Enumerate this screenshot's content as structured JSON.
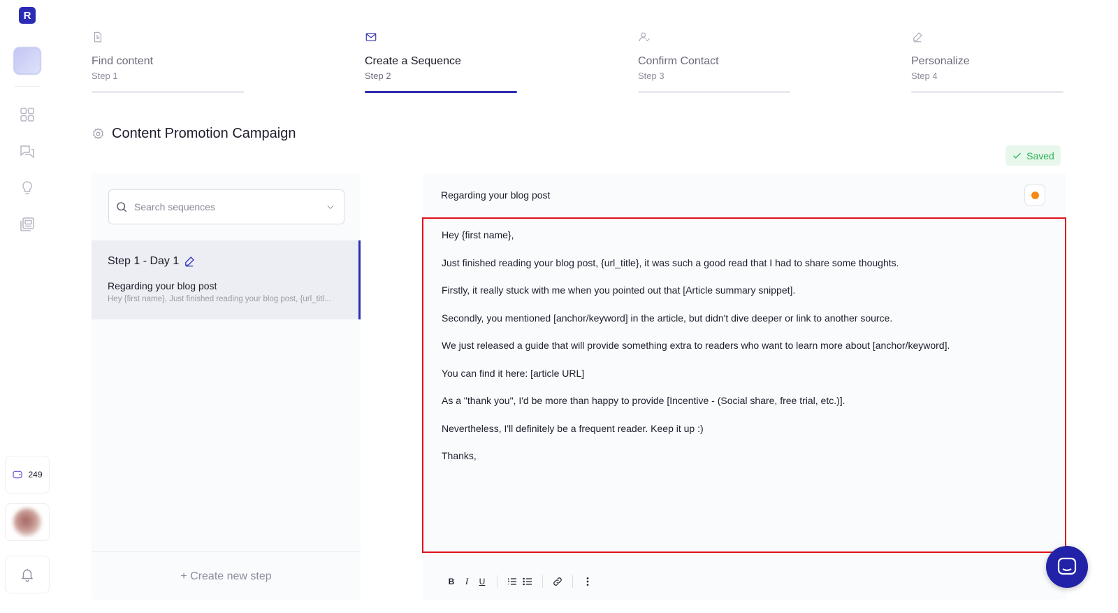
{
  "app": {
    "logo_letter": "R"
  },
  "rail": {
    "credits_count": "249"
  },
  "stepper": [
    {
      "title": "Find content",
      "sub": "Step 1",
      "icon": "document-icon"
    },
    {
      "title": "Create a Sequence",
      "sub": "Step 2",
      "icon": "mail-icon"
    },
    {
      "title": "Confirm Contact",
      "sub": "Step 3",
      "icon": "user-check-icon"
    },
    {
      "title": "Personalize",
      "sub": "Step 4",
      "icon": "pen-icon"
    }
  ],
  "campaign": {
    "title": "Content Promotion Campaign",
    "saved_label": "Saved"
  },
  "sequences": {
    "search_placeholder": "Search sequences",
    "items": [
      {
        "step_label": "Step 1 - Day 1",
        "subject": "Regarding your blog post",
        "preview": "Hey {first name}, Just finished reading your blog post, {url_titl..."
      }
    ],
    "create_label": "+ Create new step"
  },
  "editor": {
    "subject": "Regarding your blog post",
    "status_color": "#f58a16",
    "body": [
      "Hey {first name},",
      "Just finished reading your blog post, {url_title}, it was such a good read that I had to share some thoughts.",
      "Firstly, it really stuck with me when you pointed out that [Article summary snippet].",
      "Secondly, you mentioned [anchor/keyword] in the article, but didn't dive deeper or link to another source.",
      "We just released a guide that will provide something extra to readers who want to learn more about [anchor/keyword].",
      "You can find it here: [article URL]",
      "As a \"thank you\", I'd be more than happy to provide [Incentive - (Social share, free trial, etc.)].",
      "Nevertheless, I'll definitely be a frequent reader. Keep it up :)",
      "Thanks,"
    ],
    "toolbar": {
      "bold": "B",
      "italic": "I",
      "underline": "U"
    }
  },
  "colors": {
    "accent": "#2c2cb0",
    "highlight_border": "#e0121c",
    "saved_green": "#2fb457"
  }
}
